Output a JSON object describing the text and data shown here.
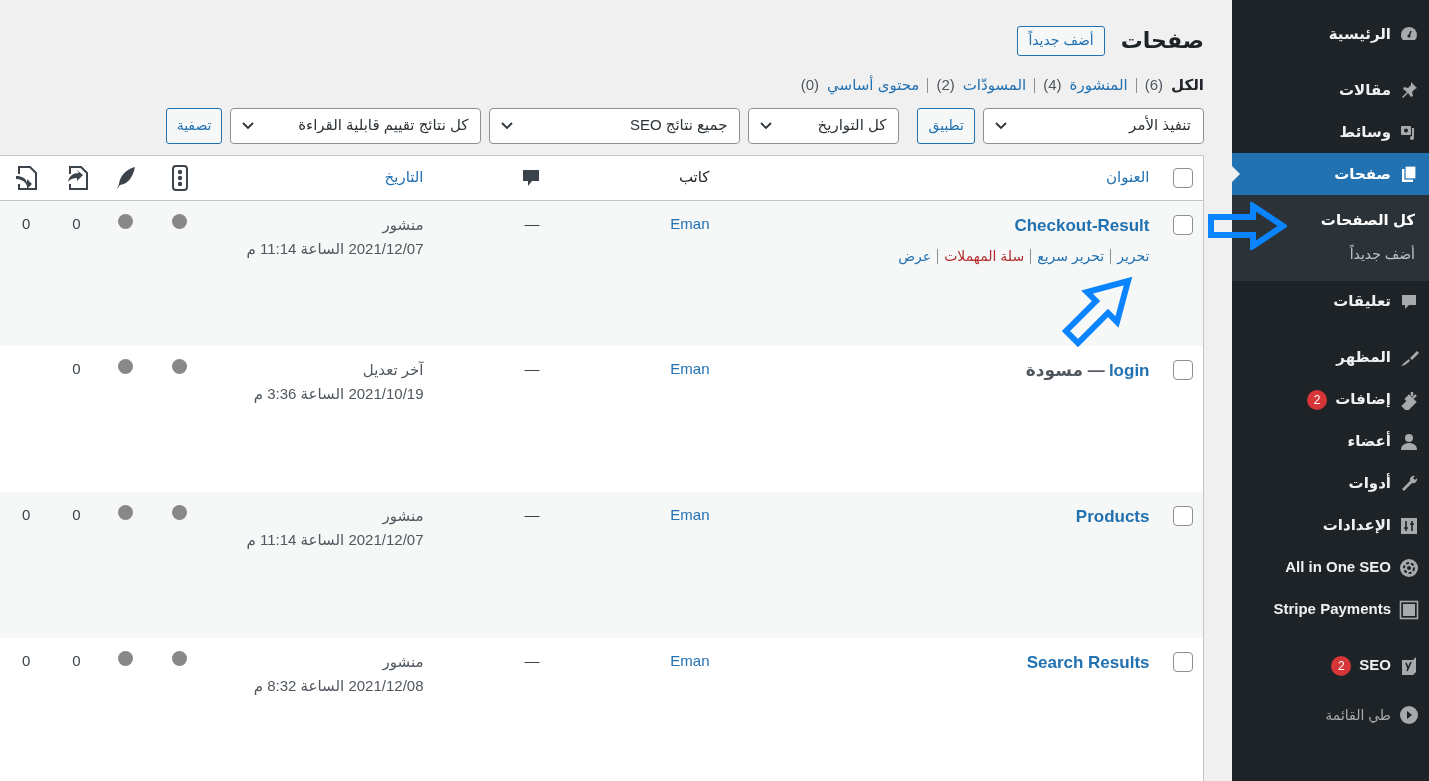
{
  "sidebar": {
    "groups": [
      {
        "items": [
          {
            "label": "الرئيسية",
            "selected": false
          }
        ]
      },
      {
        "items": [
          {
            "label": "مقالات",
            "selected": false
          },
          {
            "label": "وسائط",
            "selected": false
          },
          {
            "label": "صفحات",
            "selected": true,
            "children": [
              {
                "label": "كل الصفحات",
                "selected": true
              },
              {
                "label": "أضف جديداً",
                "selected": false
              }
            ]
          },
          {
            "label": "تعليقات",
            "selected": false
          }
        ]
      },
      {
        "items": [
          {
            "label": "المظهر",
            "selected": false
          },
          {
            "label": "إضافات",
            "selected": false,
            "badge": "2"
          },
          {
            "label": "أعضاء",
            "selected": false
          },
          {
            "label": "أدوات",
            "selected": false
          },
          {
            "label": "الإعدادات",
            "selected": false
          },
          {
            "label": "All in One SEO",
            "selected": false
          },
          {
            "label": "Stripe Payments",
            "selected": false
          }
        ]
      },
      {
        "items": [
          {
            "label": "SEO",
            "selected": false,
            "badge": "2"
          }
        ]
      }
    ],
    "collapse": {
      "label": "طي القائمة"
    }
  },
  "page": {
    "title": "صفحات",
    "add_button": "أضف جديداً"
  },
  "status_filters": [
    {
      "label": "الكل",
      "count": "(6)",
      "selected": true
    },
    {
      "label": "المنشورة",
      "count": "(4)",
      "selected": false
    },
    {
      "label": "المسودّات",
      "count": "(2)",
      "selected": false
    },
    {
      "label": "محتوى أساسي",
      "count": "(0)",
      "selected": false
    }
  ],
  "toolbar": {
    "bulk_action": "تنفيذ الأمر",
    "apply": "تطبيق",
    "date_filter": "كل التواريخ",
    "seo_filter": "جميع نتائج SEO",
    "readability_filter": "كل نتائج تقييم قابلية القراءة",
    "filter_button": "تصفية"
  },
  "table": {
    "columns": [
      {
        "kind": "check",
        "checked": false
      },
      {
        "kind": "title",
        "label": "العنوان",
        "sortable": true
      },
      {
        "kind": "author",
        "label": "كاتب",
        "sortable": false
      },
      {
        "kind": "comments"
      },
      {
        "kind": "date",
        "label": "التاريخ",
        "sortable": true
      },
      {
        "kind": "seo"
      },
      {
        "kind": "readability"
      },
      {
        "kind": "links"
      },
      {
        "kind": "linked"
      }
    ],
    "rows": [
      {
        "checked": false,
        "title": "Checkout-Result",
        "author": "Eman",
        "comments": "—",
        "date_status": "منشور",
        "date": "2021/12/07 الساعة 11:14 م",
        "links": "0",
        "linked": "0",
        "actions": [
          {
            "label": "تحرير",
            "kind": "link"
          },
          {
            "label": "تحرير سريع",
            "kind": "link"
          },
          {
            "label": "سلة المهملات",
            "kind": "trash"
          },
          {
            "label": "عرض",
            "kind": "link"
          }
        ]
      },
      {
        "checked": false,
        "title": "login",
        "state": "— مسودة",
        "author": "Eman",
        "comments": "—",
        "date_status": "آخر تعديل",
        "date": "2021/10/19 الساعة 3:36 م",
        "links": "0"
      },
      {
        "checked": false,
        "title": "Products",
        "author": "Eman",
        "comments": "—",
        "date_status": "منشور",
        "date": "2021/12/07 الساعة 11:14 م",
        "links": "0",
        "linked": "0"
      },
      {
        "checked": false,
        "title": "Search Results",
        "author": "Eman",
        "comments": "—",
        "date_status": "منشور",
        "date": "2021/12/08 الساعة 8:32 م",
        "links": "0",
        "linked": "0"
      }
    ]
  }
}
